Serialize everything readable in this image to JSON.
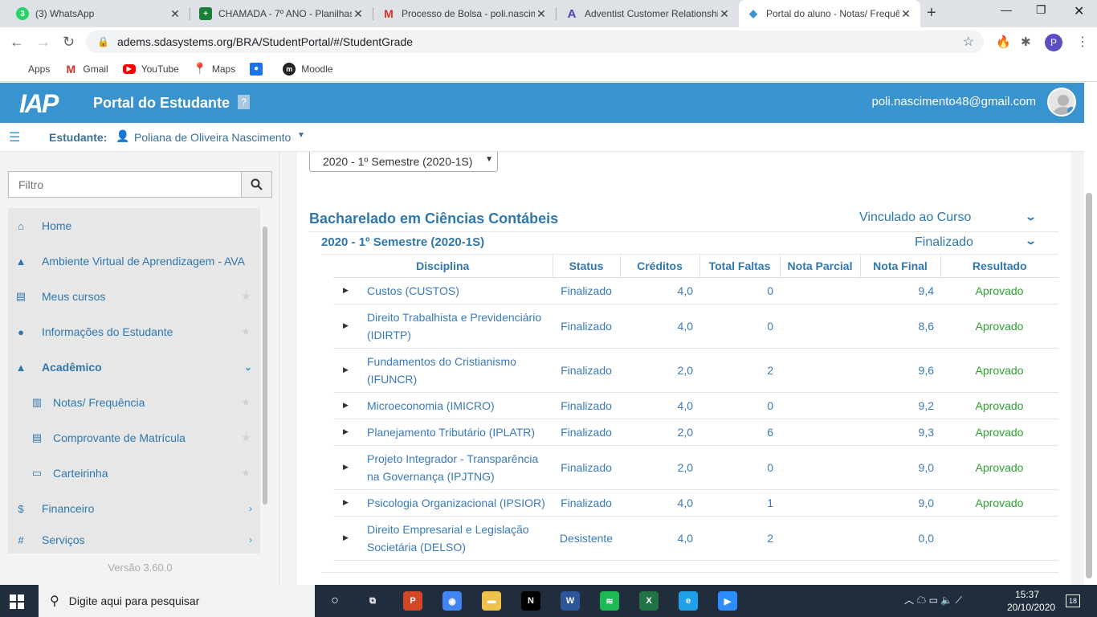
{
  "browser": {
    "tabs": [
      {
        "title": "(3) WhatsApp",
        "icon": "whatsapp-icon",
        "color": "#25d366",
        "glyph": "3"
      },
      {
        "title": "CHAMADA - 7º ANO - Planilhas",
        "icon": "sheets-icon",
        "color": "#188038",
        "glyph": "+"
      },
      {
        "title": "Processo de Bolsa - poli.nascimento",
        "icon": "gmail-icon",
        "color": "#ffffff",
        "glyph": "M"
      },
      {
        "title": "Adventist Customer Relationship",
        "icon": "adventist-icon",
        "color": "#ffffff",
        "glyph": "A"
      },
      {
        "title": "Portal do aluno - Notas/ Frequência",
        "icon": "portal-icon",
        "color": "#ffffff",
        "glyph": "◆"
      }
    ],
    "url": "adems.sdasystems.org/BRA/StudentPortal/#/StudentGrade",
    "bookmarks": [
      {
        "label": "Apps",
        "icon": "apps-icon"
      },
      {
        "label": "Gmail",
        "icon": "gmail-icon"
      },
      {
        "label": "YouTube",
        "icon": "youtube-icon"
      },
      {
        "label": "Maps",
        "icon": "maps-icon"
      },
      {
        "label": "",
        "icon": "contacts-icon"
      },
      {
        "label": "Moodle",
        "icon": "moodle-icon"
      }
    ],
    "profile_letter": "P"
  },
  "header": {
    "logo": "IAP",
    "title": "Portal do Estudante",
    "help": "?",
    "user_email": "poli.nascimento48@gmail.com"
  },
  "student": {
    "label": "Estudante:",
    "name": "Poliana de Oliveira Nascimento"
  },
  "sidebar": {
    "filter_placeholder": "Filtro",
    "items": [
      {
        "label": "Home",
        "icon": "home-icon",
        "glyph": "⌂"
      },
      {
        "label": "Ambiente Virtual de Aprendizagem - AVA",
        "icon": "graduation-cap-icon",
        "glyph": "🎓"
      },
      {
        "label": "Meus cursos",
        "icon": "document-icon",
        "glyph": "▤"
      },
      {
        "label": "Informações do Estudante",
        "icon": "user-icon",
        "glyph": "●"
      },
      {
        "label": "Acadêmico",
        "icon": "graduation-cap-icon",
        "glyph": "🎓"
      },
      {
        "label": "Notas/ Frequência",
        "icon": "bar-chart-icon",
        "glyph": "▥"
      },
      {
        "label": "Comprovante de Matrícula",
        "icon": "document-icon",
        "glyph": "▤"
      },
      {
        "label": "Carteirinha",
        "icon": "card-icon",
        "glyph": "▭"
      },
      {
        "label": "Financeiro",
        "icon": "dollar-icon",
        "glyph": "$"
      },
      {
        "label": "Serviços",
        "icon": "hash-icon",
        "glyph": "#"
      }
    ],
    "version": "Versão 3.60.0"
  },
  "content": {
    "semester_select": "2020 - 1º Semestre (2020-1S)",
    "course_name": "Bacharelado em Ciências Contábeis",
    "course_status": "Vinculado ao Curso",
    "semester_label": "2020 - 1º Semestre (2020-1S)",
    "semester_status": "Finalizado",
    "table": {
      "headers": [
        "Disciplina",
        "Status",
        "Créditos",
        "Total Faltas",
        "Nota Parcial",
        "Nota Final",
        "Resultado"
      ],
      "rows": [
        {
          "disciplina": "Custos (CUSTOS)",
          "status": "Finalizado",
          "creditos": "4,0",
          "faltas": "0",
          "parcial": "",
          "final": "9,4",
          "resultado": "Aprovado"
        },
        {
          "disciplina": "Direito Trabalhista e Previdenciário (IDIRTP)",
          "status": "Finalizado",
          "creditos": "4,0",
          "faltas": "0",
          "parcial": "",
          "final": "8,6",
          "resultado": "Aprovado"
        },
        {
          "disciplina": "Fundamentos do Cristianismo (IFUNCR)",
          "status": "Finalizado",
          "creditos": "2,0",
          "faltas": "2",
          "parcial": "",
          "final": "9,6",
          "resultado": "Aprovado"
        },
        {
          "disciplina": "Microeconomia (IMICRO)",
          "status": "Finalizado",
          "creditos": "4,0",
          "faltas": "0",
          "parcial": "",
          "final": "9,2",
          "resultado": "Aprovado"
        },
        {
          "disciplina": "Planejamento Tributário (IPLATR)",
          "status": "Finalizado",
          "creditos": "2,0",
          "faltas": "6",
          "parcial": "",
          "final": "9,3",
          "resultado": "Aprovado"
        },
        {
          "disciplina": "Projeto Integrador - Transparência na Governança (IPJTNG)",
          "status": "Finalizado",
          "creditos": "2,0",
          "faltas": "0",
          "parcial": "",
          "final": "9,0",
          "resultado": "Aprovado"
        },
        {
          "disciplina": "Psicologia Organizacional (IPSIOR)",
          "status": "Finalizado",
          "creditos": "4,0",
          "faltas": "1",
          "parcial": "",
          "final": "9,0",
          "resultado": "Aprovado"
        },
        {
          "disciplina": "Direito Empresarial e Legislação Societária (DELSO)",
          "status": "Desistente",
          "creditos": "4,0",
          "faltas": "2",
          "parcial": "",
          "final": "0,0",
          "resultado": ""
        }
      ]
    }
  },
  "taskbar": {
    "search_placeholder": "Digite aqui para pesquisar",
    "time": "15:37",
    "date": "20/10/2020",
    "notifications": "18",
    "apps": [
      {
        "name": "task-view-icon",
        "color": "#1f2d3d",
        "glyph": "⧉"
      },
      {
        "name": "powerpoint-icon",
        "color": "#d24726",
        "glyph": "P"
      },
      {
        "name": "chrome-icon",
        "color": "#4285f4",
        "glyph": "◉"
      },
      {
        "name": "file-explorer-icon",
        "color": "#f0c24b",
        "glyph": "▬"
      },
      {
        "name": "netflix-icon",
        "color": "#000000",
        "glyph": "N"
      },
      {
        "name": "word-icon",
        "color": "#2b579a",
        "glyph": "W"
      },
      {
        "name": "spotify-icon",
        "color": "#1db954",
        "glyph": "≋"
      },
      {
        "name": "excel-icon",
        "color": "#217346",
        "glyph": "X"
      },
      {
        "name": "edge-icon",
        "color": "#1fa0e8",
        "glyph": "e"
      },
      {
        "name": "zoom-icon",
        "color": "#2d8cff",
        "glyph": "▶"
      }
    ]
  }
}
